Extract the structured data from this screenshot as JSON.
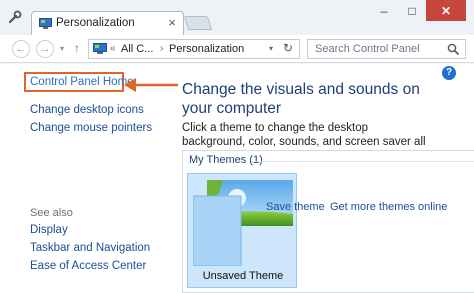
{
  "tab": {
    "title": "Personalization",
    "close": "×"
  },
  "window_buttons": {
    "minimize": "–",
    "maximize": "□",
    "close": "✕"
  },
  "nav": {
    "back": "←",
    "forward": "→",
    "up": "↑",
    "breadcrumb": [
      "All C...",
      "Personalization"
    ],
    "separator": "«",
    "crumb_separator": "›",
    "dropdown": "▾",
    "refresh": "↻",
    "search_placeholder": "Search Control Panel"
  },
  "sidebar": {
    "home": "Control Panel Home",
    "links": [
      "Change desktop icons",
      "Change mouse pointers"
    ],
    "see_also_label": "See also",
    "see_also": [
      "Display",
      "Taskbar and Navigation",
      "Ease of Access Center"
    ]
  },
  "main": {
    "help": "?",
    "title": "Change the visuals and sounds on your computer",
    "description": "Click a theme to change the desktop background, color, sounds, and screen saver all at once.",
    "themes_header": "My Themes (1)",
    "themes": [
      {
        "label": "Unsaved Theme"
      }
    ],
    "bottom_links": [
      "Save theme",
      "Get more themes online"
    ]
  },
  "colors": {
    "annotation_arrow": "#e0652a",
    "link": "#1b4f98",
    "title": "#1f3e79",
    "close_button": "#c7463c"
  }
}
